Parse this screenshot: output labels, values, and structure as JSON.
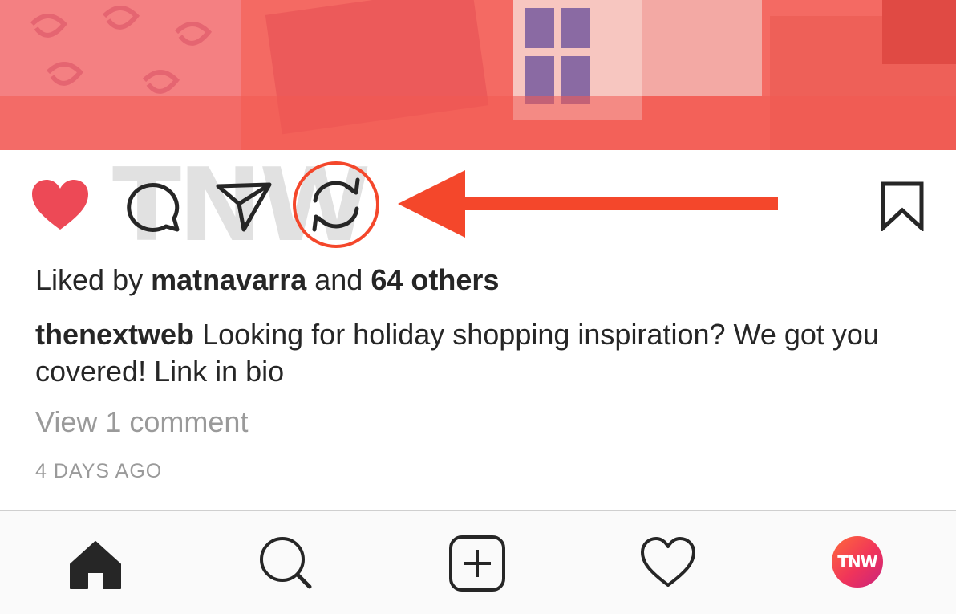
{
  "post": {
    "watermark": "TNW",
    "likes": {
      "prefix": "Liked by",
      "user": "matnavarra",
      "conjunction": "and",
      "others": "64 others"
    },
    "caption": {
      "username": "thenextweb",
      "text": "Looking for holiday shopping inspiration? We got you covered! Link in bio"
    },
    "view_comments": "View 1 comment",
    "timestamp": "4 DAYS AGO",
    "actions": [
      "heart-icon",
      "comment-icon",
      "share-icon",
      "repost-icon",
      "bookmark-icon"
    ],
    "annotation_color": "#f4472b",
    "like_color": "#ed4956"
  },
  "tabbar": {
    "items": [
      "home-icon",
      "search-icon",
      "add-post-icon",
      "activity-heart-icon",
      "profile-avatar"
    ],
    "avatar_text": "TNW"
  }
}
